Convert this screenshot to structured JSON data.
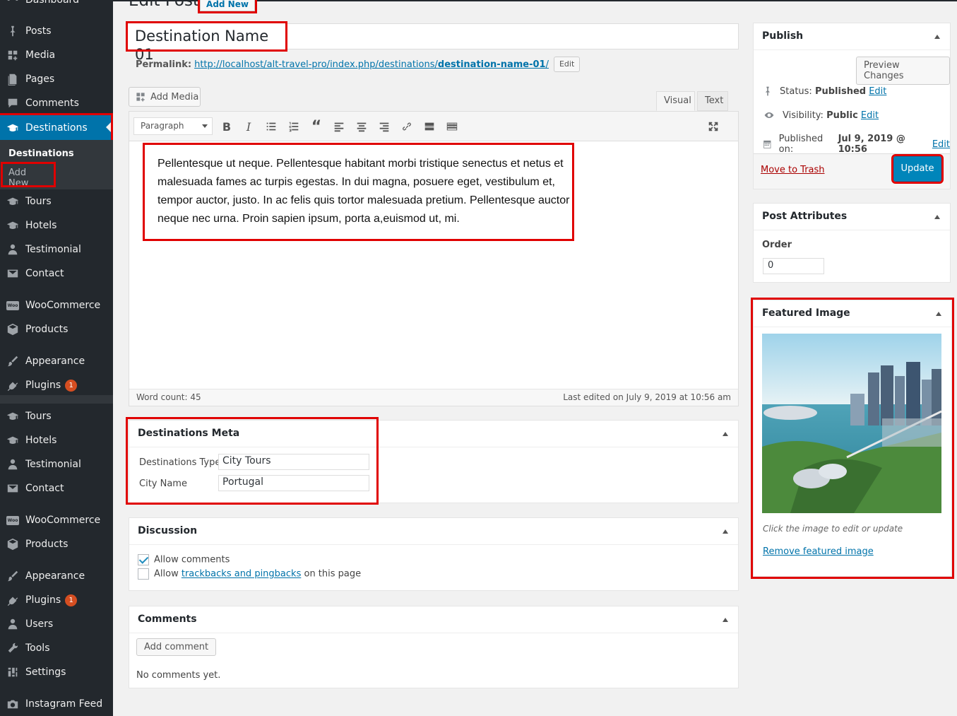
{
  "sidebar": {
    "dashboard": "Dashboard",
    "items": [
      {
        "label": "Posts",
        "icon": "pin-icon"
      },
      {
        "label": "Media",
        "icon": "media-icon"
      },
      {
        "label": "Pages",
        "icon": "pages-icon"
      },
      {
        "label": "Comments",
        "icon": "comments-icon"
      },
      {
        "label": "Destinations",
        "icon": "mortarboard-icon"
      },
      {
        "label": "Tours",
        "icon": "mortarboard-icon"
      },
      {
        "label": "Hotels",
        "icon": "mortarboard-icon"
      },
      {
        "label": "Testimonial",
        "icon": "user-icon"
      },
      {
        "label": "Contact",
        "icon": "mail-icon"
      },
      {
        "label": "WooCommerce",
        "icon": "woo-icon"
      },
      {
        "label": "Products",
        "icon": "box-icon"
      },
      {
        "label": "Appearance",
        "icon": "brush-icon"
      },
      {
        "label": "Plugins",
        "icon": "plug-icon",
        "badge": "1"
      },
      {
        "label": "Tours",
        "icon": "mortarboard-icon"
      },
      {
        "label": "Hotels",
        "icon": "mortarboard-icon"
      },
      {
        "label": "Testimonial",
        "icon": "user-icon"
      },
      {
        "label": "Contact",
        "icon": "mail-icon"
      },
      {
        "label": "WooCommerce",
        "icon": "woo-icon"
      },
      {
        "label": "Products",
        "icon": "box-icon"
      },
      {
        "label": "Appearance",
        "icon": "brush-icon"
      },
      {
        "label": "Plugins",
        "icon": "plug-icon",
        "badge": "1"
      },
      {
        "label": "Users",
        "icon": "user-icon"
      },
      {
        "label": "Tools",
        "icon": "wrench-icon"
      },
      {
        "label": "Settings",
        "icon": "settings-icon"
      },
      {
        "label": "Instagram Feed",
        "icon": "camera-icon"
      }
    ],
    "submenu": {
      "title": "Destinations",
      "add_new": "Add New"
    },
    "woo_text": "Woo",
    "accent": "#0073aa"
  },
  "header": {
    "title": "Edit Post",
    "add_new": "Add New"
  },
  "post": {
    "title": "Destination Name 01",
    "permalink_label": "Permalink:",
    "permalink_base": "http://localhost/alt-travel-pro/index.php/destinations/",
    "permalink_slug": "destination-name-01",
    "permalink_end": "/",
    "edit_btn": "Edit"
  },
  "editor": {
    "add_media": "Add Media",
    "tab_visual": "Visual",
    "tab_text": "Text",
    "format": "Paragraph",
    "content": "Pellentesque ut neque. Pellentesque habitant morbi tristique senectus et netus et malesuada fames ac turpis egestas. In dui magna, posuere eget, vestibulum et, tempor auctor, justo. In ac felis quis tortor malesuada pretium. Pellentesque auctor neque nec urna. Proin sapien ipsum, porta a,euismod ut, mi.",
    "word_count": "Word count: 45",
    "last_edited": "Last edited on July 9, 2019 at 10:56 am"
  },
  "dest_meta": {
    "title": "Destinations Meta",
    "type_label": "Destinations Type",
    "type_value": "City Tours",
    "city_label": "City Name",
    "city_value": "Portugal"
  },
  "discussion": {
    "title": "Discussion",
    "allow_comments": "Allow comments",
    "allow_prefix": "Allow",
    "trackbacks_link": "trackbacks and pingbacks",
    "allow_suffix": "on this page"
  },
  "comments": {
    "title": "Comments",
    "add_btn": "Add comment",
    "none": "No comments yet."
  },
  "publish": {
    "title": "Publish",
    "preview": "Preview Changes",
    "status_label": "Status:",
    "status_value": "Published",
    "visibility_label": "Visibility:",
    "visibility_value": "Public",
    "published_label": "Published on:",
    "published_value": "Jul 9, 2019 @ 10:56",
    "edit": "Edit",
    "trash": "Move to Trash",
    "update": "Update"
  },
  "attributes": {
    "title": "Post Attributes",
    "order_label": "Order",
    "order_value": "0"
  },
  "featured": {
    "title": "Featured Image",
    "hint": "Click the image to edit or update",
    "remove": "Remove featured image"
  }
}
